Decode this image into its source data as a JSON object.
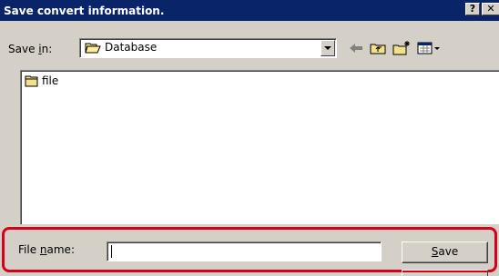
{
  "window": {
    "title": "Save convert information.",
    "help_label": "?",
    "close_label": "✕"
  },
  "save_in": {
    "label_pre": "Save ",
    "label_key": "i",
    "label_post": "n:",
    "folder": "Database",
    "folder_icon": "open-folder-icon",
    "toolbar_icons": [
      "back-arrow-icon",
      "up-folder-icon",
      "new-folder-icon",
      "view-menu-icon"
    ]
  },
  "files": [
    {
      "name": "file",
      "icon": "folder-icon"
    }
  ],
  "file_name": {
    "label_pre": "File ",
    "label_key": "n",
    "label_post": "ame:",
    "value": ""
  },
  "save_button": {
    "key": "S",
    "rest": "ave"
  },
  "colors": {
    "title_bar": "#0a246a",
    "dialog_face": "#d4d0c8",
    "highlight": "#d6001c",
    "folder_yellow": "#f2e08a"
  }
}
